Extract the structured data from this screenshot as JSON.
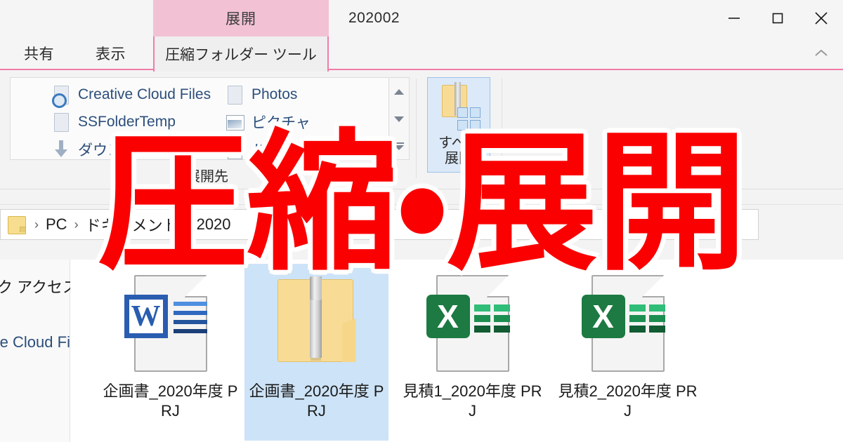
{
  "window": {
    "contextual_tab_header": "展開",
    "title": "202002",
    "controls": {
      "minimize": "minimize-icon",
      "maximize": "maximize-icon",
      "close": "close-icon",
      "collapse_ribbon": "chevron-up-icon"
    }
  },
  "ribbon_tabs": [
    {
      "label": "共有"
    },
    {
      "label": "表示"
    },
    {
      "label": "圧縮フォルダー ツール"
    }
  ],
  "ribbon": {
    "destination_group": {
      "label": "展開先",
      "items": [
        {
          "label": "Creative Cloud Files",
          "icon": "creative-cloud-folder-icon"
        },
        {
          "label": "SSFolderTemp",
          "icon": "folder-icon"
        },
        {
          "label": "ダウンロード",
          "icon": "download-arrow-icon"
        },
        {
          "label": "Photos",
          "icon": "folder-icon"
        },
        {
          "label": "ピクチャ",
          "icon": "pictures-folder-icon"
        },
        {
          "label": "ドキュメント",
          "icon": "documents-folder-icon"
        }
      ],
      "scroll": {
        "up": "scroll-up-icon",
        "down": "scroll-down-icon",
        "more": "gallery-more-icon"
      }
    },
    "extract_all_button": {
      "caption_line1": "すべて",
      "caption_line2": "展開",
      "icon": "zip-extract-icon"
    }
  },
  "address_bar": {
    "folder_icon": "folder-icon",
    "crumbs": [
      "PC",
      "ドキュメント",
      "2020"
    ],
    "separator": "›"
  },
  "nav_pane": {
    "items": [
      {
        "label": "クイック アクセス"
      },
      {
        "label": "Creative Cloud Files"
      }
    ]
  },
  "files": [
    {
      "name": "企画書_2020年度 PRJ",
      "type": "word",
      "icon": "word-document-icon",
      "selected": false
    },
    {
      "name": "企画書_2020年度 PRJ",
      "type": "zip",
      "icon": "zip-folder-icon",
      "selected": true
    },
    {
      "name": "見積1_2020年度 PRJ",
      "type": "excel",
      "icon": "excel-document-icon",
      "selected": false
    },
    {
      "name": "見積2_2020年度 PRJ",
      "type": "excel",
      "icon": "excel-document-icon",
      "selected": false
    }
  ],
  "overlay": {
    "text": "圧縮・展開",
    "color": "#fb0000",
    "outline_color": "#ffffff"
  },
  "colors": {
    "contextual_tab_pink": "#f2c2d4",
    "contextual_tab_border": "#f07ca8",
    "selection_blue": "#cde3f7",
    "word_blue": "#2a5db0",
    "excel_green": "#1c7a42",
    "folder_yellow": "#f8dc96"
  },
  "glyphs": {
    "badge_word": "W",
    "badge_excel": "X"
  }
}
